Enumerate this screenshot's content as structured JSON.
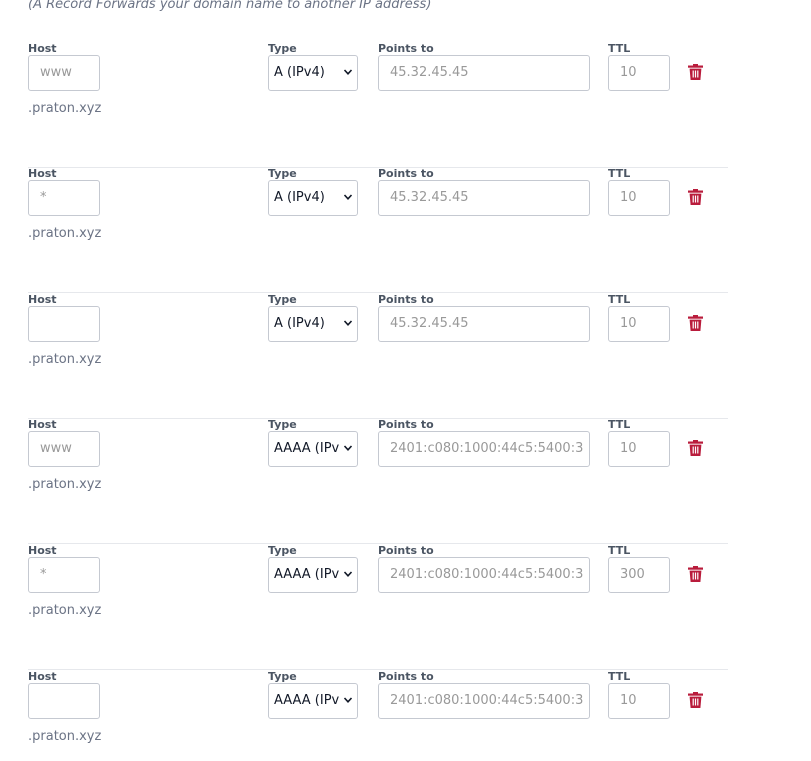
{
  "intro_text": "(A Record Forwards your domain name to another IP address)",
  "labels": {
    "host": "Host",
    "type": "Type",
    "points_to": "Points to",
    "ttl": "TTL",
    "suffix": ".praton.xyz"
  },
  "colors": {
    "trash": "#b91c3c",
    "label": "#4b5563",
    "placeholder": "#999999"
  },
  "records": [
    {
      "host": "www",
      "type": "A (IPv4)",
      "points_to": "45.32.45.45",
      "ttl": "10"
    },
    {
      "host": "*",
      "type": "A (IPv4)",
      "points_to": "45.32.45.45",
      "ttl": "10"
    },
    {
      "host": "",
      "type": "A (IPv4)",
      "points_to": "45.32.45.45",
      "ttl": "10"
    },
    {
      "host": "www",
      "type": "AAAA (IPv",
      "points_to": "2401:c080:1000:44c5:5400:3",
      "ttl": "10"
    },
    {
      "host": "*",
      "type": "AAAA (IPv",
      "points_to": "2401:c080:1000:44c5:5400:3",
      "ttl": "300"
    },
    {
      "host": "",
      "type": "AAAA (IPv",
      "points_to": "2401:c080:1000:44c5:5400:3",
      "ttl": "10"
    }
  ]
}
